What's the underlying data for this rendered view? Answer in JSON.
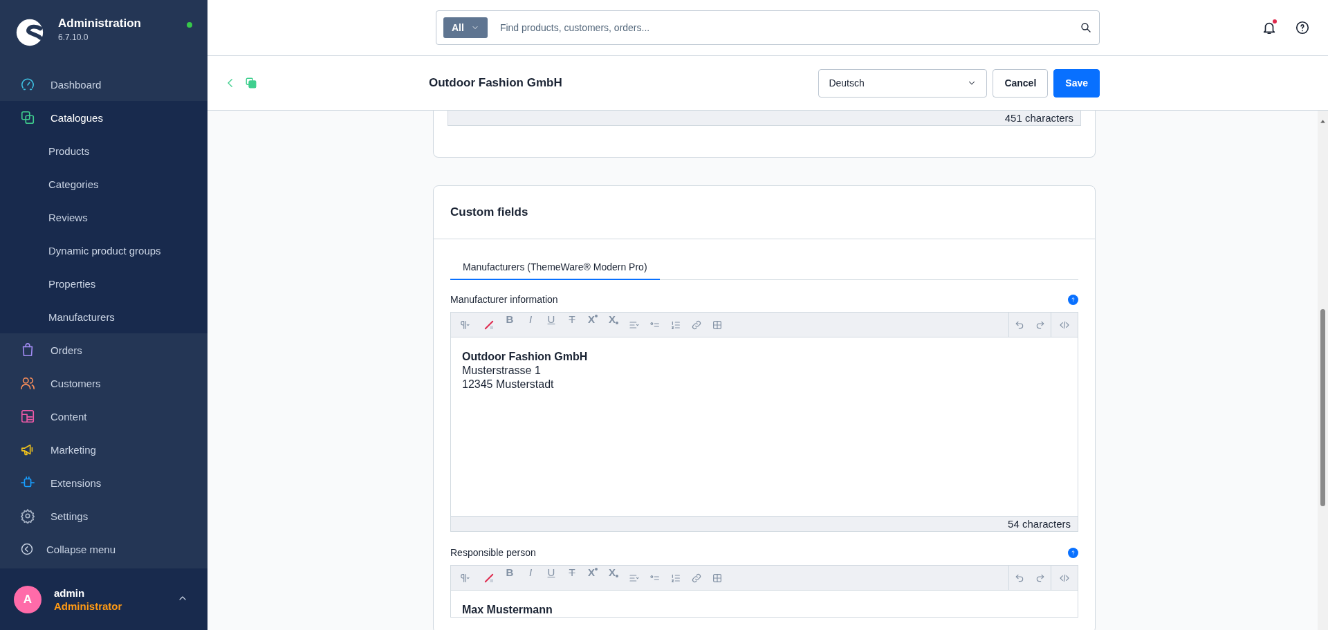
{
  "brand": {
    "title": "Administration",
    "version": "6.7.10.0",
    "online": true
  },
  "sidebar": {
    "items": [
      {
        "label": "Dashboard",
        "color": "#3ebfe0",
        "expanded": false
      },
      {
        "label": "Catalogues",
        "color": "#3fcf8e",
        "expanded": true,
        "children": [
          {
            "label": "Products"
          },
          {
            "label": "Categories"
          },
          {
            "label": "Reviews"
          },
          {
            "label": "Dynamic product groups"
          },
          {
            "label": "Properties"
          },
          {
            "label": "Manufacturers"
          }
        ]
      },
      {
        "label": "Orders",
        "color": "#a18bf2",
        "expanded": false
      },
      {
        "label": "Customers",
        "color": "#f98e5a",
        "expanded": false
      },
      {
        "label": "Content",
        "color": "#ef5aa8",
        "expanded": false
      },
      {
        "label": "Marketing",
        "color": "#f0c21b",
        "expanded": false
      },
      {
        "label": "Extensions",
        "color": "#189eff",
        "expanded": false
      },
      {
        "label": "Settings",
        "color": "#a9b5c7",
        "expanded": false
      }
    ],
    "collapse_label": "Collapse menu",
    "user": {
      "initial": "A",
      "name": "admin",
      "role": "Administrator"
    }
  },
  "search": {
    "scope": "All",
    "placeholder": "Find products, customers, orders..."
  },
  "notifications": {
    "unread": true
  },
  "action_bar": {
    "title": "Outdoor Fashion GmbH",
    "language": "Deutsch",
    "buttons": [
      "Cancel",
      "Save"
    ]
  },
  "previous_card": {
    "count": "451 characters"
  },
  "custom_fields": {
    "title": "Custom fields",
    "tabs": [
      {
        "label": "Manufacturers (ThemeWare® Modern Pro)",
        "selected": true
      }
    ],
    "editors": [
      {
        "label": "Manufacturer information",
        "format_letters": [
          "B",
          "I",
          "U",
          "T",
          "X",
          "X"
        ],
        "lines": [
          {
            "text": "Outdoor Fashion GmbH",
            "bold": true
          },
          {
            "text": "Musterstrasse 1",
            "bold": false
          },
          {
            "text": "12345 Musterstadt",
            "bold": false
          }
        ],
        "count": "54 characters"
      },
      {
        "label": "Responsible person",
        "format_letters": [
          "B",
          "I",
          "U",
          "T",
          "X",
          "X"
        ],
        "lines": [
          {
            "text": "Max Mustermann",
            "bold": true
          }
        ]
      }
    ]
  }
}
